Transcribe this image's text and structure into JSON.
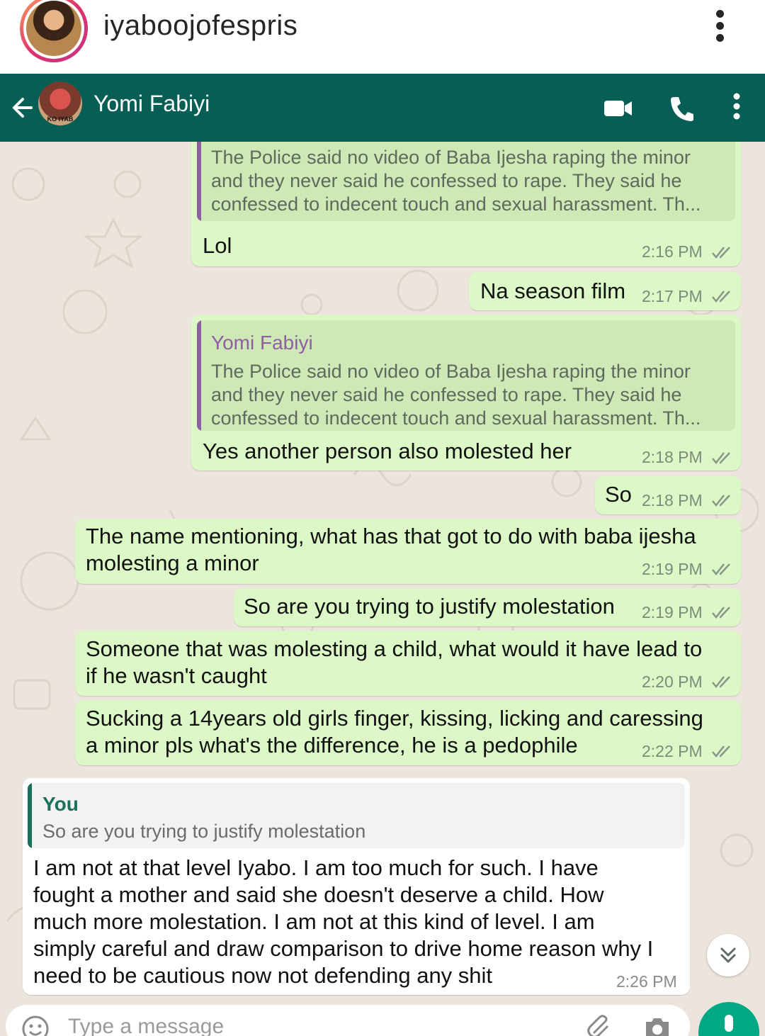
{
  "instagram": {
    "username": "iyaboojofespris"
  },
  "chat_header": {
    "contact_name": "Yomi Fabiyi",
    "avatar_caption": "KO IYAB"
  },
  "colors": {
    "header": "#075e54",
    "outgoing_bubble": "#dcf8c6",
    "incoming_bubble": "#ffffff",
    "quote_bar_out": "#8e5fa3",
    "quote_bar_in": "#1c6f5a",
    "read_ticks": "#8a958a"
  },
  "messages": [
    {
      "direction": "outgoing",
      "quote": {
        "sender": "Yomi Fabiyi",
        "lines": [
          "The Police said no video of Baba Ijesha raping the minor",
          "and they never said he confessed to rape. They said he",
          "confessed to indecent touch and sexual harassment. Th..."
        ]
      },
      "lines": [
        "Lol"
      ],
      "time": "2:16 PM"
    },
    {
      "direction": "outgoing",
      "lines": [
        "Na season film"
      ],
      "time": "2:17 PM"
    },
    {
      "direction": "outgoing",
      "quote": {
        "sender": "Yomi Fabiyi",
        "lines": [
          "The Police said no video of Baba Ijesha raping the minor",
          "and they never said he confessed to rape. They said he",
          "confessed to indecent touch and sexual harassment. Th..."
        ]
      },
      "lines": [
        "Yes another person also molested her"
      ],
      "time": "2:18 PM"
    },
    {
      "direction": "outgoing",
      "lines": [
        "So"
      ],
      "time": "2:18 PM"
    },
    {
      "direction": "outgoing",
      "lines": [
        "The name mentioning, what has that got to do with baba ijesha",
        "molesting a minor"
      ],
      "time": "2:19 PM"
    },
    {
      "direction": "outgoing",
      "lines": [
        "So are you trying to justify molestation"
      ],
      "time": "2:19 PM"
    },
    {
      "direction": "outgoing",
      "lines": [
        "Someone that was molesting a child, what would it have lead to",
        "if he wasn't caught"
      ],
      "time": "2:20 PM"
    },
    {
      "direction": "outgoing",
      "lines": [
        "Sucking a 14years old girls finger, kissing, licking and caressing",
        "a minor pls what's the difference, he is a pedophile"
      ],
      "time": "2:22 PM"
    },
    {
      "direction": "incoming",
      "quote": {
        "sender": "You",
        "lines": [
          "So are you trying to justify molestation"
        ]
      },
      "lines": [
        "I am not at that level Iyabo. I am too much for such. I have",
        "fought a mother and said she doesn't deserve a child. How",
        "much more molestation. I am not at this kind of level. I am",
        "simply careful and draw comparison to drive home reason why I",
        "need to be cautious now not defending any shit"
      ],
      "time": "2:26 PM"
    }
  ],
  "composer": {
    "placeholder": "Type a message"
  },
  "icons": [
    "back-arrow-icon",
    "video-call-icon",
    "phone-icon",
    "more-vertical-icon",
    "double-check-icon",
    "chevron-double-down-icon",
    "emoji-icon",
    "attach-icon",
    "camera-icon",
    "mic-icon"
  ]
}
